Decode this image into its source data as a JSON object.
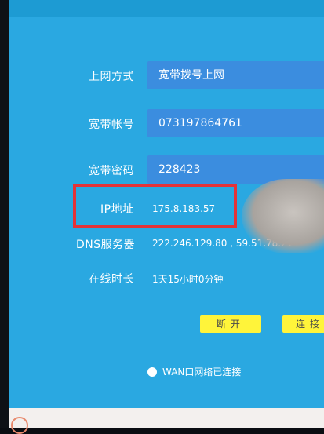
{
  "form": {
    "connection_type": {
      "label": "上网方式",
      "value": "宽带拨号上网"
    },
    "account": {
      "label": "宽带帐号",
      "value": "073197864761"
    },
    "password": {
      "label": "宽带密码",
      "value": "228423"
    }
  },
  "status": {
    "ip": {
      "label": "IP地址",
      "value": "175.8.183.57"
    },
    "dns": {
      "label": "DNS服务器",
      "value": "222.246.129.80 , 59.51.78.21"
    },
    "uptime": {
      "label": "在线时长",
      "value": "1天15小时0分钟"
    }
  },
  "buttons": {
    "disconnect": "断开",
    "connect": "连接"
  },
  "wan_status": "WAN口网络已连接",
  "colors": {
    "background": "#2aa8e1",
    "field": "#3b8ddf",
    "button": "#fff43a",
    "highlight": "#e53238"
  }
}
